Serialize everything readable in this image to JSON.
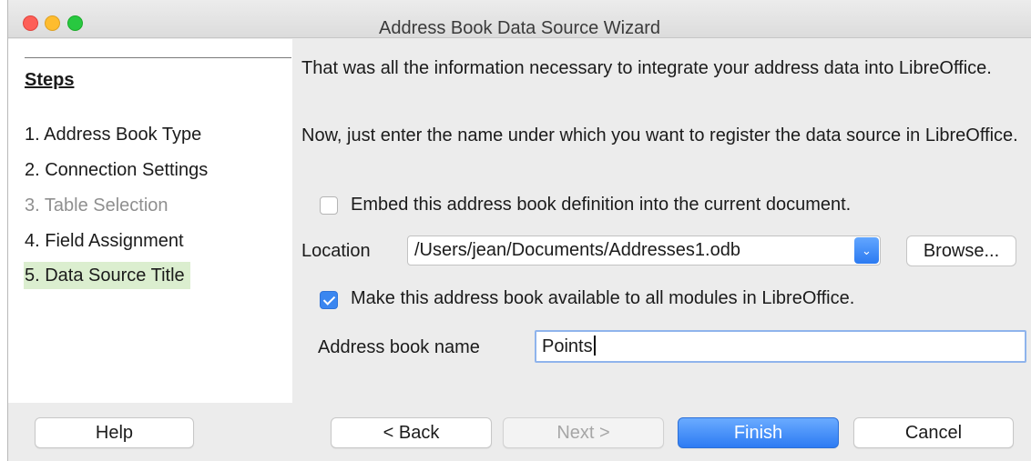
{
  "window": {
    "title": "Address Book Data Source Wizard"
  },
  "sidebar": {
    "heading": "Steps",
    "steps": [
      {
        "label": "1. Address Book Type",
        "state": "done"
      },
      {
        "label": "2. Connection Settings",
        "state": "done"
      },
      {
        "label": "3. Table Selection",
        "state": "disabled"
      },
      {
        "label": "4. Field Assignment",
        "state": "done"
      },
      {
        "label": "5. Data Source Title",
        "state": "current"
      }
    ]
  },
  "content": {
    "intro_text": "That was all the information necessary to integrate your address data into LibreOffice.",
    "instruction_text": "Now, just enter the name under which you want to register the data source in LibreOffice.",
    "embed_checkbox": {
      "label": "Embed this address book definition into the current document.",
      "checked": false
    },
    "location": {
      "label": "Location",
      "value": "/Users/jean/Documents/Addresses1.odb",
      "browse_label": "Browse..."
    },
    "available_checkbox": {
      "label": "Make this address book available to all modules in LibreOffice.",
      "checked": true
    },
    "address_book_name": {
      "label": "Address book name",
      "value": "Points"
    }
  },
  "buttons": {
    "help": "Help",
    "back": "< Back",
    "next": "Next >",
    "finish": "Finish",
    "cancel": "Cancel"
  },
  "colors": {
    "accent": "#3a86f0",
    "current_step_bg": "#dbeecf",
    "window_bg": "#ececec"
  }
}
